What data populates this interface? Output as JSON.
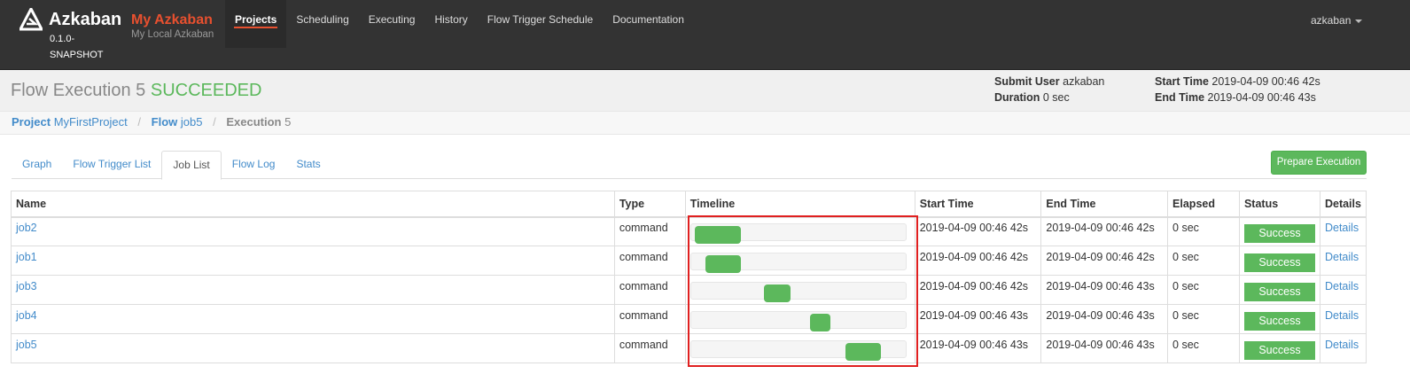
{
  "navbar": {
    "brand_name": "Azkaban",
    "version": "0.1.0-SNAPSHOT",
    "site_title": "My Azkaban",
    "site_subtitle": "My Local Azkaban",
    "items": [
      {
        "label": "Projects",
        "active": true
      },
      {
        "label": "Scheduling",
        "active": false
      },
      {
        "label": "Executing",
        "active": false
      },
      {
        "label": "History",
        "active": false
      },
      {
        "label": "Flow Trigger Schedule",
        "active": false
      },
      {
        "label": "Documentation",
        "active": false
      }
    ],
    "user": "azkaban"
  },
  "header": {
    "title_prefix": "Flow Execution 5",
    "status": "SUCCEEDED",
    "submit_user_label": "Submit User",
    "submit_user": "azkaban",
    "duration_label": "Duration",
    "duration": "0 sec",
    "start_time_label": "Start Time",
    "start_time": "2019-04-09 00:46 42s",
    "end_time_label": "End Time",
    "end_time": "2019-04-09 00:46 43s"
  },
  "breadcrumb": {
    "project_label": "Project",
    "project": "MyFirstProject",
    "flow_label": "Flow",
    "flow": "job5",
    "execution_label": "Execution",
    "execution": "5"
  },
  "tabs": [
    "Graph",
    "Flow Trigger List",
    "Job List",
    "Flow Log",
    "Stats"
  ],
  "active_tab": "Job List",
  "prepare_button": "Prepare Execution",
  "table": {
    "columns": [
      "Name",
      "Type",
      "Timeline",
      "Start Time",
      "End Time",
      "Elapsed",
      "Status",
      "Details"
    ],
    "rows": [
      {
        "name": "job2",
        "type": "command",
        "timeline": [
          0.0,
          0.22
        ],
        "start": "2019-04-09 00:46 42s",
        "end": "2019-04-09 00:46 42s",
        "elapsed": "0 sec",
        "status": "Success",
        "details": "Details"
      },
      {
        "name": "job1",
        "type": "command",
        "timeline": [
          0.05,
          0.22
        ],
        "start": "2019-04-09 00:46 42s",
        "end": "2019-04-09 00:46 42s",
        "elapsed": "0 sec",
        "status": "Success",
        "details": "Details"
      },
      {
        "name": "job3",
        "type": "command",
        "timeline": [
          0.33,
          0.46
        ],
        "start": "2019-04-09 00:46 42s",
        "end": "2019-04-09 00:46 43s",
        "elapsed": "0 sec",
        "status": "Success",
        "details": "Details"
      },
      {
        "name": "job4",
        "type": "command",
        "timeline": [
          0.55,
          0.65
        ],
        "start": "2019-04-09 00:46 43s",
        "end": "2019-04-09 00:46 43s",
        "elapsed": "0 sec",
        "status": "Success",
        "details": "Details"
      },
      {
        "name": "job5",
        "type": "command",
        "timeline": [
          0.72,
          0.89
        ],
        "start": "2019-04-09 00:46 43s",
        "end": "2019-04-09 00:46 43s",
        "elapsed": "0 sec",
        "status": "Success",
        "details": "Details"
      }
    ]
  },
  "colors": {
    "navbar_bg": "#333333",
    "accent": "#e8502f",
    "success": "#5cb85c",
    "link": "#428bca",
    "highlight": "#e02020"
  }
}
